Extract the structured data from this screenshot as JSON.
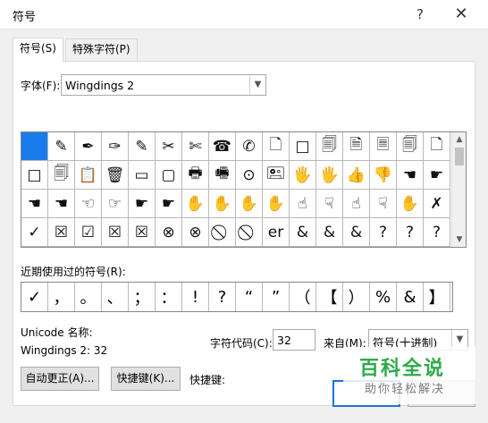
{
  "window": {
    "title": "符号",
    "help_label": "?",
    "close_label": "✕"
  },
  "tabs": [
    {
      "label": "符号(S)"
    },
    {
      "label": "特殊字符(P)"
    }
  ],
  "font": {
    "label": "字体(F):",
    "value": "Wingdings 2"
  },
  "symbols": [
    [
      "",
      "✎",
      "✒",
      "✑",
      "✎",
      "✂",
      "✄",
      "☎",
      "✆",
      "🗋",
      "□",
      "🗐",
      "🗎",
      "🗏",
      "🗐",
      "🗋"
    ],
    [
      "□",
      "🗐",
      "📋",
      "🗑",
      "▭",
      "▢",
      "🖶",
      "🖷",
      "⊙",
      "🖭",
      "🖐",
      "🖐",
      "👍",
      "👎",
      "☚",
      "☛"
    ],
    [
      "☚",
      "☚",
      "☜",
      "☞",
      "☛",
      "☛",
      "✋",
      "✋",
      "✋",
      "✋",
      "☝",
      "☟",
      "☝",
      "☟",
      "✋",
      "✗"
    ],
    [
      "✓",
      "☒",
      "☑",
      "☒",
      "☒",
      "⊗",
      "⊗",
      "⃠",
      "⃠",
      "er",
      "&",
      "&",
      "&",
      "?",
      "?",
      "?"
    ]
  ],
  "recent": {
    "label": "近期使用过的符号(R):",
    "items": [
      "✓",
      "，",
      "。",
      "、",
      "；",
      "：",
      "!",
      "?",
      "“",
      "”",
      "（",
      "【",
      "）",
      "%",
      "&",
      "】"
    ]
  },
  "unicode": {
    "label": "Unicode 名称:",
    "value": "Wingdings 2: 32"
  },
  "charcode": {
    "label": "字符代码(C):",
    "value": "32"
  },
  "from": {
    "label": "来自(M):",
    "value": "符号(十进制)"
  },
  "buttons": {
    "autocorrect": "自动更正(A)...",
    "shortcut_key": "快捷键(K)...",
    "shortcut_label": "快捷键:"
  },
  "watermark": {
    "line1": "百科全说",
    "line2": "助你轻松解决"
  }
}
